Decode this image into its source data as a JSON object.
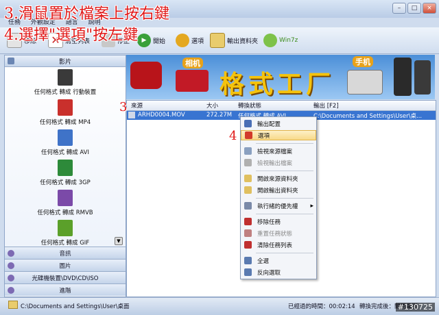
{
  "overlay": {
    "line1": "3.滑鼠置於檔案上按右鍵",
    "line2": "4.選擇\"選項\"按左鍵",
    "marker3": "3",
    "marker4": "4"
  },
  "menubar": [
    "任務",
    "外觀設定",
    "語言",
    "說明"
  ],
  "toolbar": {
    "add": "移除",
    "clear": "清空列表",
    "stop": "停止",
    "start": "開始",
    "options": "選項",
    "output": "輸出資料夾",
    "win7": "Win7z"
  },
  "sidebar": {
    "video_header": "影片",
    "formats": [
      {
        "label": "任何格式 轉成 行動裝置",
        "icon": "mobile-device-icon",
        "color": "#3a3a3a"
      },
      {
        "label": "任何格式 轉成 MP4",
        "icon": "mp4-icon",
        "color": "#c9302c"
      },
      {
        "label": "任何格式 轉成 AVI",
        "icon": "avi-icon",
        "color": "#3f73c8"
      },
      {
        "label": "任何格式 轉成 3GP",
        "icon": "3gp-icon",
        "color": "#2d8a3a"
      },
      {
        "label": "任何格式 轉成 RMVB",
        "icon": "rmvb-icon",
        "color": "#7b4aa8"
      },
      {
        "label": "任何格式 轉成 GIF",
        "icon": "gif-icon",
        "color": "#5ba02a"
      }
    ],
    "lower": [
      {
        "label": "音訊",
        "icon": "audio-icon"
      },
      {
        "label": "圖片",
        "icon": "picture-icon"
      },
      {
        "label": "光碟機裝置\\DVD\\CD\\ISO",
        "icon": "disc-icon"
      },
      {
        "label": "進階",
        "icon": "advanced-icon"
      }
    ]
  },
  "banner": {
    "title": "格式工厂",
    "tag_camera": "相机",
    "tag_phone": "手机"
  },
  "filelist": {
    "columns": [
      "來源",
      "大小",
      "轉換狀態",
      "輸出 [F2]"
    ],
    "rows": [
      {
        "source": "ARHD0004.MOV",
        "size": "272.27M",
        "status": "任何格式 轉成 AVI",
        "output": "C:\\Documents and Settings\\User\\桌..."
      }
    ]
  },
  "context_menu": {
    "items": [
      {
        "label": "輸出配置",
        "icon": "output-config-icon",
        "enabled": true,
        "highlight": false
      },
      {
        "label": "選項",
        "icon": "options-icon",
        "enabled": true,
        "highlight": true
      },
      {
        "label": "檢視來源檔案",
        "icon": "view-source-icon",
        "enabled": true,
        "highlight": false
      },
      {
        "label": "檢視輸出檔案",
        "icon": "view-output-icon",
        "enabled": false,
        "highlight": false
      },
      {
        "label": "開啟來源資料夾",
        "icon": "open-source-folder-icon",
        "enabled": true,
        "highlight": false
      },
      {
        "label": "開啟輸出資料夾",
        "icon": "open-output-folder-icon",
        "enabled": true,
        "highlight": false
      },
      {
        "label": "執行緒的優先權",
        "icon": "priority-icon",
        "enabled": true,
        "highlight": false,
        "submenu": true
      },
      {
        "label": "移除任務",
        "icon": "remove-task-icon",
        "enabled": true,
        "highlight": false
      },
      {
        "label": "重置任務狀態",
        "icon": "reset-task-icon",
        "enabled": false,
        "highlight": false
      },
      {
        "label": "清除任務列表",
        "icon": "clear-list-icon",
        "enabled": true,
        "highlight": false
      },
      {
        "label": "全選",
        "icon": "select-all-icon",
        "enabled": true,
        "highlight": false
      },
      {
        "label": "反向選取",
        "icon": "invert-select-icon",
        "enabled": true,
        "highlight": false
      }
    ]
  },
  "statusbar": {
    "path": "C:\\Documents and Settings\\User\\桌面",
    "elapsed": "已經過的時間：00:02:14",
    "after": "轉換完成後：關閉電腦"
  },
  "watermark": "#130725",
  "colors": {
    "accent": "#3874d1",
    "overlay_text": "#e01818",
    "banner_title": "#f5c30c"
  }
}
